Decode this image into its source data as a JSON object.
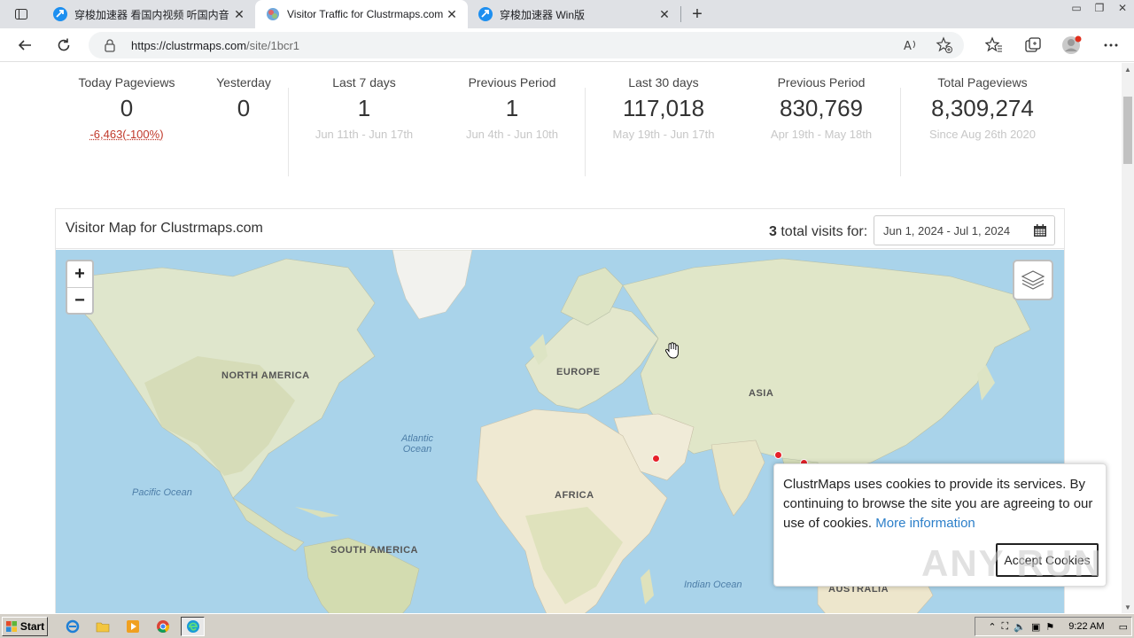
{
  "browser": {
    "tabs": [
      {
        "title": "穿梭加速器 看国内视频 听国内音",
        "icon": "arrow-blue-icon"
      },
      {
        "title": "Visitor Traffic for Clustrmaps.com",
        "icon": "clustrmaps-icon"
      },
      {
        "title": "穿梭加速器 Win版",
        "icon": "arrow-blue-icon"
      }
    ],
    "url_host": "https://clustrmaps.com",
    "url_path": "/site/1bcr1"
  },
  "stats": {
    "today": {
      "label": "Today Pageviews",
      "value": "0",
      "change": "-6,463(-100%)"
    },
    "yesterday": {
      "label": "Yesterday",
      "value": "0"
    },
    "last7": {
      "label": "Last 7 days",
      "value": "1",
      "range": "Jun 11th - Jun 17th"
    },
    "prev7": {
      "label": "Previous Period",
      "value": "1",
      "range": "Jun 4th - Jun 10th"
    },
    "last30": {
      "label": "Last 30 days",
      "value": "117,018",
      "range": "May 19th - Jun 17th"
    },
    "prev30": {
      "label": "Previous Period",
      "value": "830,769",
      "range": "Apr 19th - May 18th"
    },
    "total": {
      "label": "Total Pageviews",
      "value": "8,309,274",
      "range": "Since Aug 26th 2020"
    }
  },
  "map": {
    "title": "Visitor Map for Clustrmaps.com",
    "visits_count": "3",
    "visits_text": "total visits for:",
    "date_range": "Jun 1, 2024 - Jul 1, 2024",
    "labels": {
      "north_america": "NORTH AMERICA",
      "europe": "EUROPE",
      "asia": "ASIA",
      "africa": "AFRICA",
      "south_america": "SOUTH AMERICA",
      "australia": "AUSTRALIA",
      "atlantic": "Atlantic Ocean",
      "pacific": "Pacific Ocean",
      "indian": "Indian Ocean"
    },
    "zoom_in": "+",
    "zoom_out": "−"
  },
  "cookie": {
    "text": "ClustrMaps uses cookies to provide its services. By continuing to browse the site you are agreeing to our use of cookies.",
    "link": "More information",
    "button": "Accept Cookies"
  },
  "watermark": "ANY RUN",
  "taskbar": {
    "start": "Start",
    "clock": "9:22 AM"
  }
}
